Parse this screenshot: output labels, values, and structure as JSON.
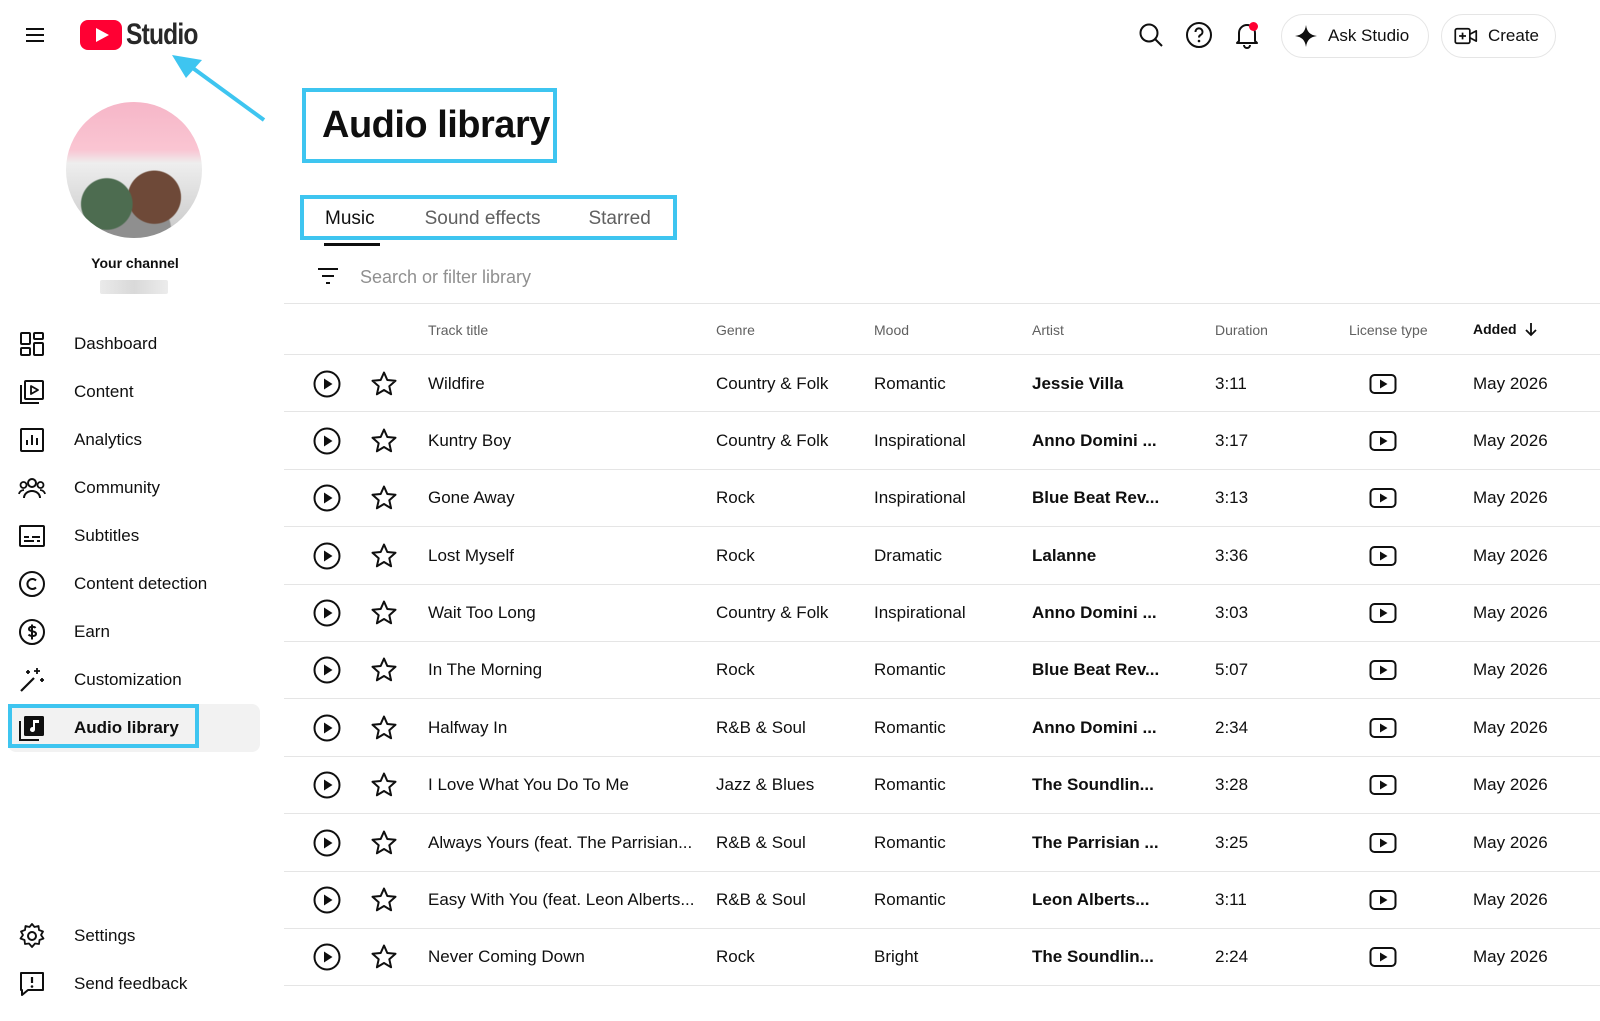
{
  "header": {
    "logo_text": "Studio",
    "ask_studio_label": "Ask Studio",
    "create_label": "Create"
  },
  "sidebar": {
    "your_channel_label": "Your channel",
    "items": [
      {
        "label": "Dashboard",
        "icon": "dashboard-icon"
      },
      {
        "label": "Content",
        "icon": "content-icon"
      },
      {
        "label": "Analytics",
        "icon": "analytics-icon"
      },
      {
        "label": "Community",
        "icon": "community-icon"
      },
      {
        "label": "Subtitles",
        "icon": "subtitles-icon"
      },
      {
        "label": "Content detection",
        "icon": "copyright-icon"
      },
      {
        "label": "Earn",
        "icon": "dollar-icon"
      },
      {
        "label": "Customization",
        "icon": "magic-wand-icon"
      },
      {
        "label": "Audio library",
        "icon": "audio-library-icon",
        "active": true
      }
    ],
    "bottom_items": [
      {
        "label": "Settings",
        "icon": "gear-icon"
      },
      {
        "label": "Send feedback",
        "icon": "feedback-icon"
      }
    ]
  },
  "main": {
    "page_title": "Audio library",
    "tabs": [
      {
        "label": "Music",
        "active": true
      },
      {
        "label": "Sound effects"
      },
      {
        "label": "Starred"
      }
    ],
    "search": {
      "placeholder": "Search or filter library",
      "value": ""
    },
    "table": {
      "columns": {
        "track_title": "Track title",
        "genre": "Genre",
        "mood": "Mood",
        "artist": "Artist",
        "duration": "Duration",
        "license_type": "License type",
        "added": "Added"
      },
      "sort": {
        "column": "Added",
        "direction": "descending"
      },
      "rows": [
        {
          "title": "Wildfire",
          "genre": "Country & Folk",
          "mood": "Romantic",
          "artist": "Jessie Villa",
          "duration": "3:11",
          "added": "May 2026"
        },
        {
          "title": "Kuntry Boy",
          "genre": "Country & Folk",
          "mood": "Inspirational",
          "artist": "Anno Domini ...",
          "duration": "3:17",
          "added": "May 2026"
        },
        {
          "title": "Gone Away",
          "genre": "Rock",
          "mood": "Inspirational",
          "artist": "Blue Beat Rev...",
          "duration": "3:13",
          "added": "May 2026"
        },
        {
          "title": "Lost Myself",
          "genre": "Rock",
          "mood": "Dramatic",
          "artist": "Lalanne",
          "duration": "3:36",
          "added": "May 2026"
        },
        {
          "title": "Wait Too Long",
          "genre": "Country & Folk",
          "mood": "Inspirational",
          "artist": "Anno Domini ...",
          "duration": "3:03",
          "added": "May 2026"
        },
        {
          "title": "In The Morning",
          "genre": "Rock",
          "mood": "Romantic",
          "artist": "Blue Beat Rev...",
          "duration": "5:07",
          "added": "May 2026"
        },
        {
          "title": "Halfway In",
          "genre": "R&B & Soul",
          "mood": "Romantic",
          "artist": "Anno Domini ...",
          "duration": "2:34",
          "added": "May 2026"
        },
        {
          "title": "I Love What You Do To Me",
          "genre": "Jazz & Blues",
          "mood": "Romantic",
          "artist": "The Soundlin...",
          "duration": "3:28",
          "added": "May 2026"
        },
        {
          "title": "Always Yours (feat. The Parrisian...",
          "genre": "R&B & Soul",
          "mood": "Romantic",
          "artist": "The Parrisian ...",
          "duration": "3:25",
          "added": "May 2026"
        },
        {
          "title": "Easy With You (feat. Leon Alberts...",
          "genre": "R&B & Soul",
          "mood": "Romantic",
          "artist": "Leon Alberts...",
          "duration": "3:11",
          "added": "May 2026"
        },
        {
          "title": "Never Coming Down",
          "genre": "Rock",
          "mood": "Bright",
          "artist": "The Soundlin...",
          "duration": "2:24",
          "added": "May 2026"
        }
      ]
    }
  },
  "colors": {
    "brand_red": "#ff0033",
    "highlight": "#3ec5f0",
    "text_primary": "#0f0f0f",
    "text_secondary": "#606060"
  }
}
